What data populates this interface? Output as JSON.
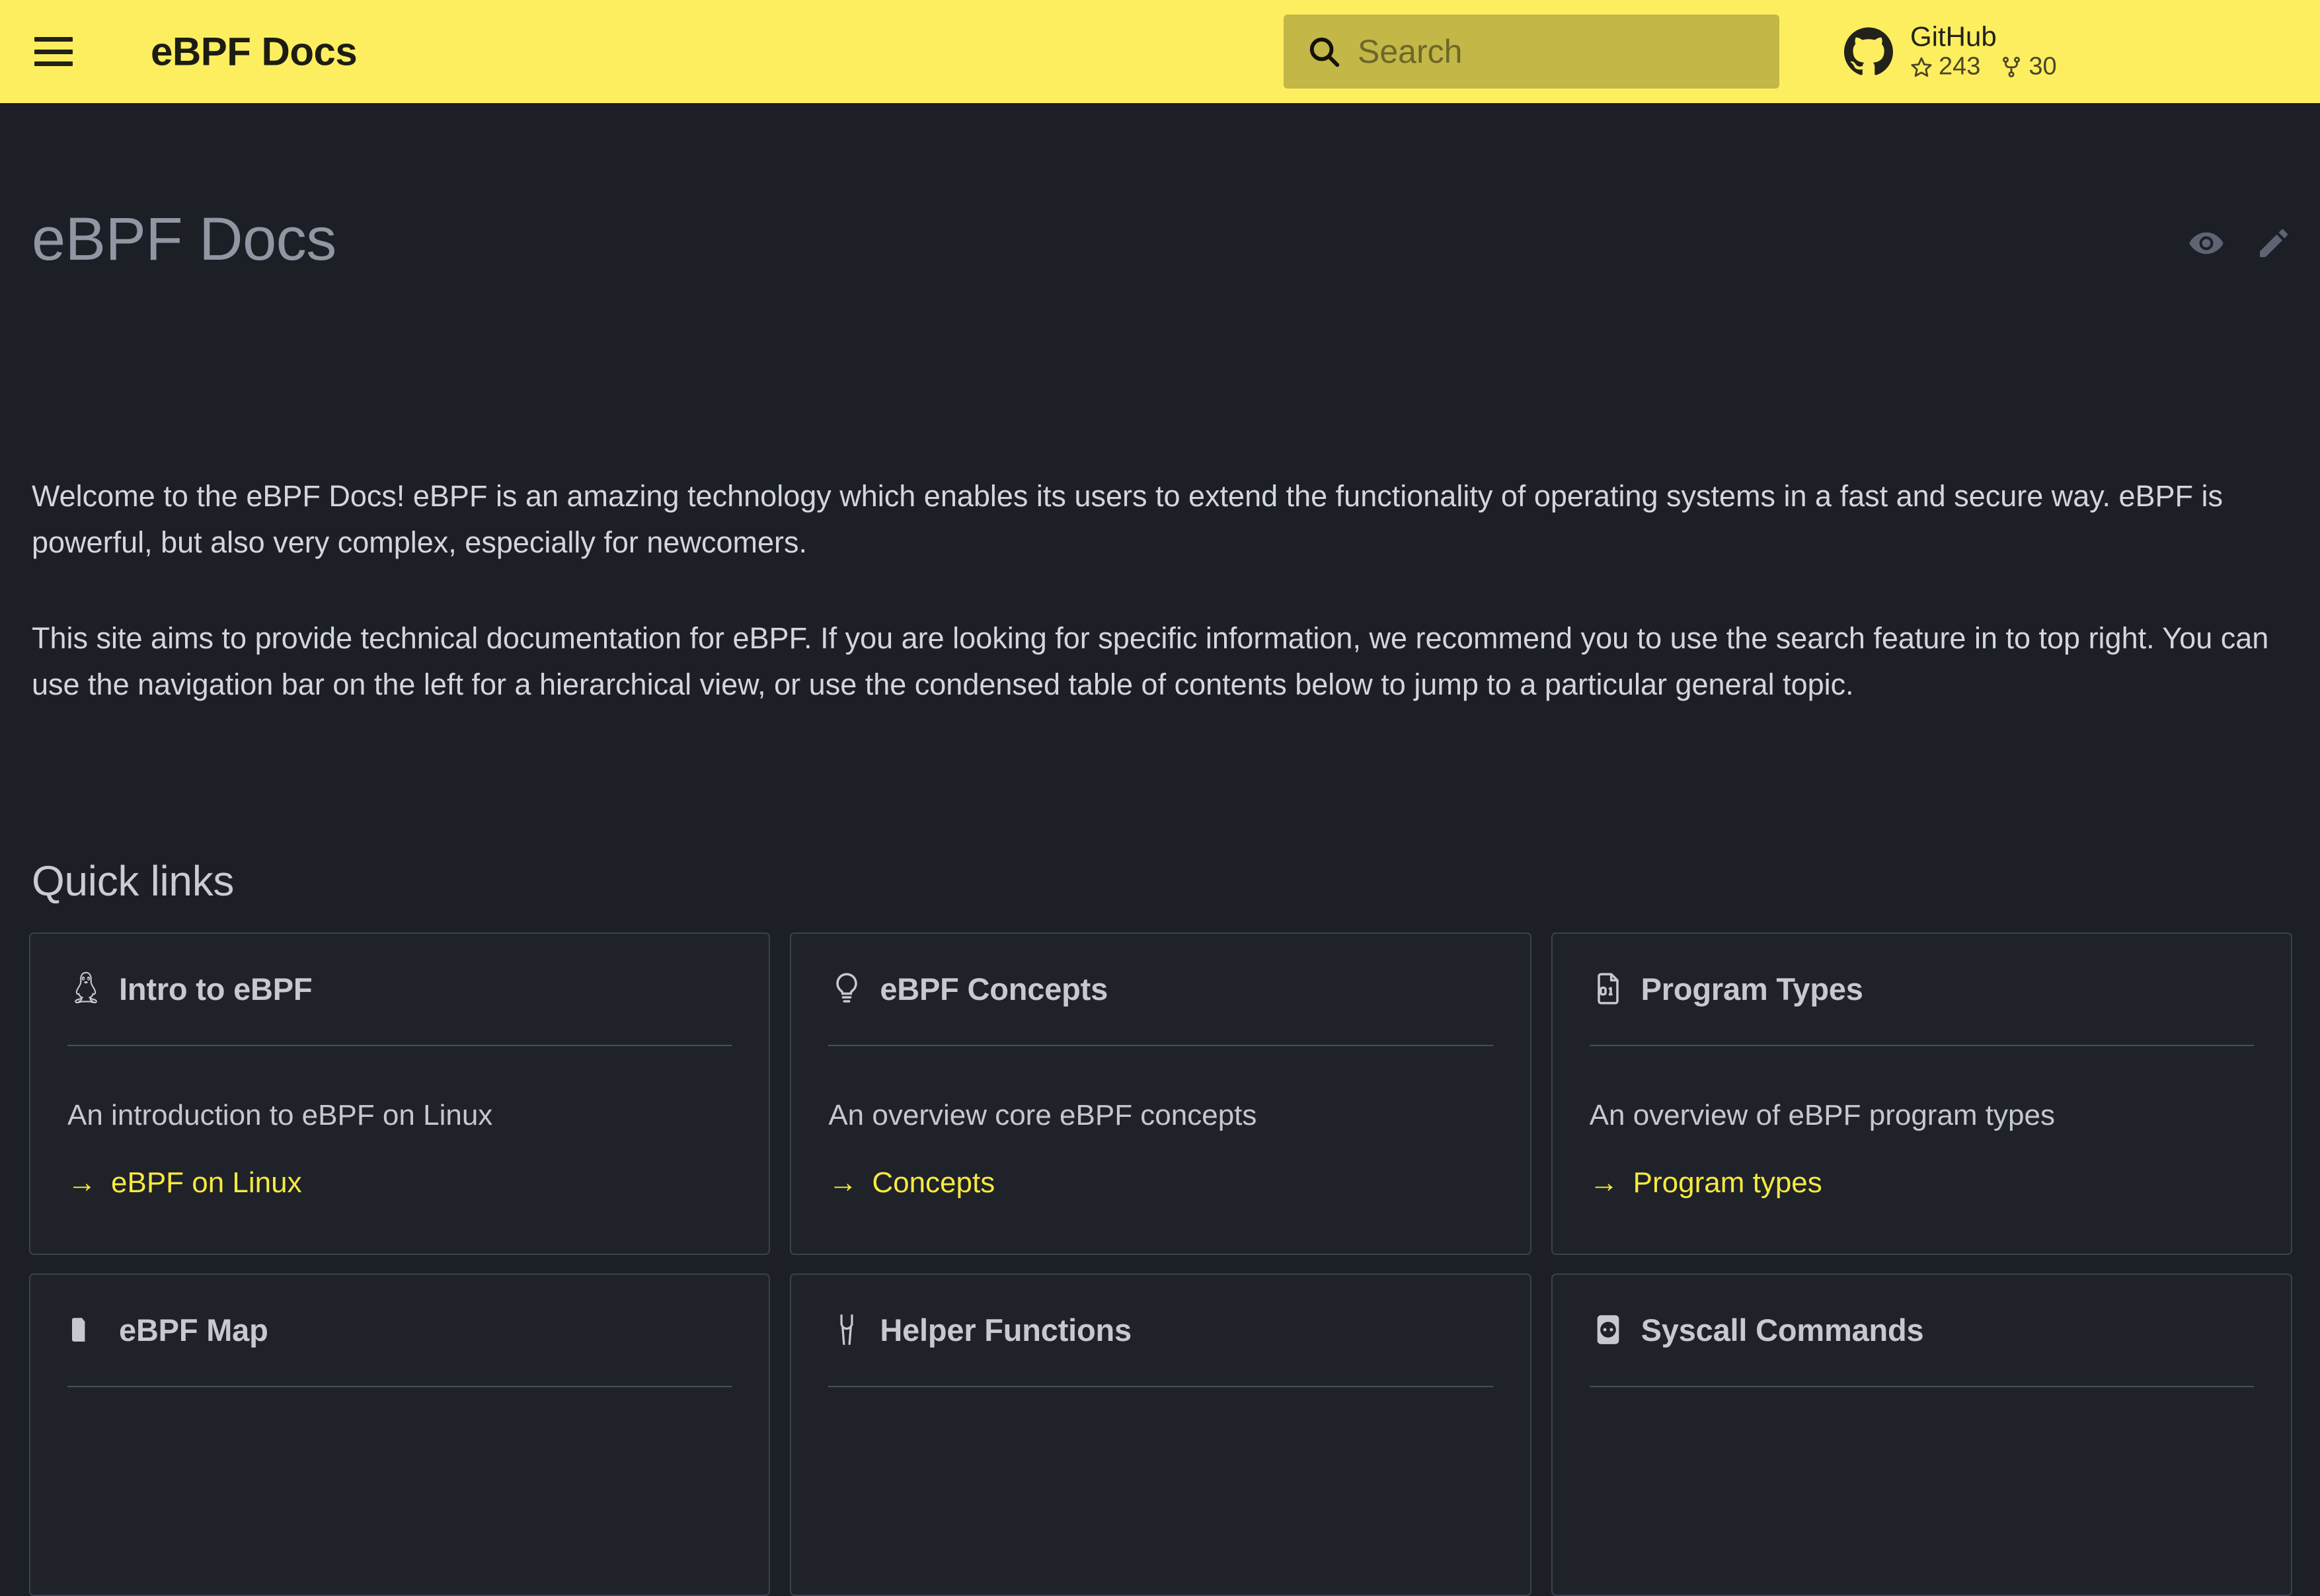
{
  "header": {
    "menu_icon": "hamburger-menu-icon",
    "site_title": "eBPF Docs",
    "search": {
      "icon": "search-icon",
      "placeholder": "Search",
      "value": ""
    },
    "github": {
      "icon": "github-logo-icon",
      "name": "GitHub",
      "stars_icon": "star-icon",
      "stars": "243",
      "forks_icon": "fork-icon",
      "forks": "30"
    }
  },
  "page": {
    "title": "eBPF Docs",
    "actions": [
      {
        "name": "view-source-icon",
        "label": "View source"
      },
      {
        "name": "edit-page-icon",
        "label": "Edit this page"
      }
    ],
    "paragraphs": [
      "Welcome to the eBPF Docs! eBPF is an amazing technology which enables its users to extend the functionality of operating systems in a fast and secure way. eBPF is powerful, but also very complex, especially for newcomers.",
      "This site aims to provide technical documentation for eBPF. If you are looking for specific information, we recommend you to use the search feature in to top right. You can use the navigation bar on the left for a hierarchical view, or use the condensed table of contents below to jump to a particular general topic."
    ],
    "quick_links_heading": "Quick links",
    "cards": [
      {
        "icon": "linux-penguin-icon",
        "title": "Intro to eBPF",
        "description": "An introduction to eBPF on Linux",
        "link_label": "eBPF on Linux",
        "link_arrow": "→"
      },
      {
        "icon": "lightbulb-icon",
        "title": "eBPF Concepts",
        "description": "An overview core eBPF concepts",
        "link_label": "Concepts",
        "link_arrow": "→"
      },
      {
        "icon": "file-binary-icon",
        "title": "Program Types",
        "description": "An overview of eBPF program types",
        "link_label": "Program types",
        "link_arrow": "→"
      },
      {
        "icon": "folder-icon",
        "title": "eBPF Map",
        "description": "",
        "link_label": "",
        "link_arrow": ""
      },
      {
        "icon": "wrench-icon",
        "title": "Helper Functions",
        "description": "",
        "link_label": "",
        "link_arrow": ""
      },
      {
        "icon": "power-socket-icon",
        "title": "Syscall Commands",
        "description": "",
        "link_label": "",
        "link_arrow": ""
      }
    ]
  },
  "colors": {
    "header_bg": "#fcee5f",
    "search_bg": "#c2b747",
    "page_bg": "#1c1f26",
    "card_bg": "#1f2229",
    "card_border": "#3b404c",
    "accent_link": "#f7e93f",
    "body_text": "#d3d6db",
    "title_text": "#9096a2"
  }
}
